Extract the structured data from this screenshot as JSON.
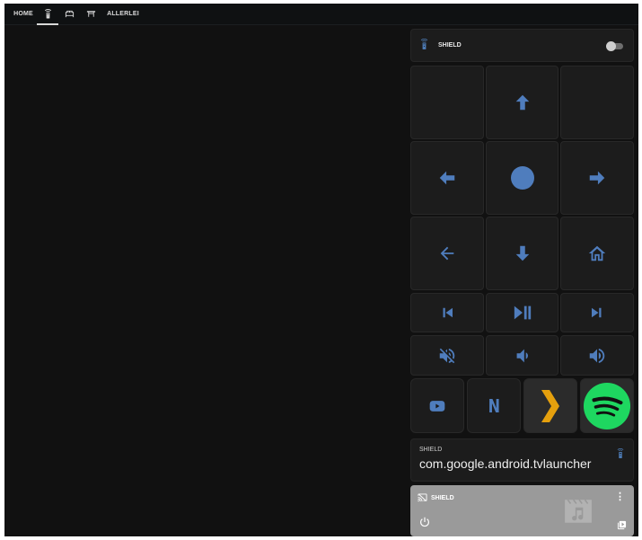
{
  "topbar": {
    "tabs": [
      {
        "label": "HOME",
        "icon": null
      },
      {
        "label": "",
        "icon": "remote-icon",
        "active": true
      },
      {
        "label": "",
        "icon": "bed-icon"
      },
      {
        "label": "",
        "icon": "table-icon"
      },
      {
        "label": "ALLERLEI",
        "icon": null
      }
    ]
  },
  "remote_header": {
    "name": "SHIELD",
    "icon": "remote-icon",
    "toggle_on": false
  },
  "dpad": {
    "up": "arrow-up-icon",
    "left": "arrow-left-icon",
    "center": "select-circle-icon",
    "right": "arrow-right-icon",
    "back": "back-arrow-icon",
    "down": "arrow-down-icon",
    "home": "home-icon"
  },
  "media_controls": [
    "previous-track-icon",
    "play-pause-icon",
    "next-track-icon"
  ],
  "volume_controls": [
    "volume-mute-icon",
    "volume-down-icon",
    "volume-up-icon"
  ],
  "apps": [
    {
      "name": "youtube",
      "icon": "youtube-icon"
    },
    {
      "name": "netflix",
      "icon": "netflix-icon",
      "letter": "N"
    },
    {
      "name": "plex",
      "icon": "plex-icon"
    },
    {
      "name": "spotify",
      "icon": "spotify-icon"
    }
  ],
  "source_card": {
    "label": "SHIELD",
    "value": "com.google.android.tvlauncher",
    "icon": "remote-icon"
  },
  "media_card": {
    "name": "SHIELD",
    "cast_icon": "cast-icon",
    "more": "⋮",
    "power_icon": "power-icon",
    "browse_icon": "browse-media-icon",
    "art_icon": "music-video-icon"
  },
  "colors": {
    "background": "#111111",
    "card": "#1c1c1c",
    "accent": "#4f7dbd",
    "plex": "#e5a00d",
    "spotify": "#1ed760",
    "media_card": "#9a9a9a"
  }
}
